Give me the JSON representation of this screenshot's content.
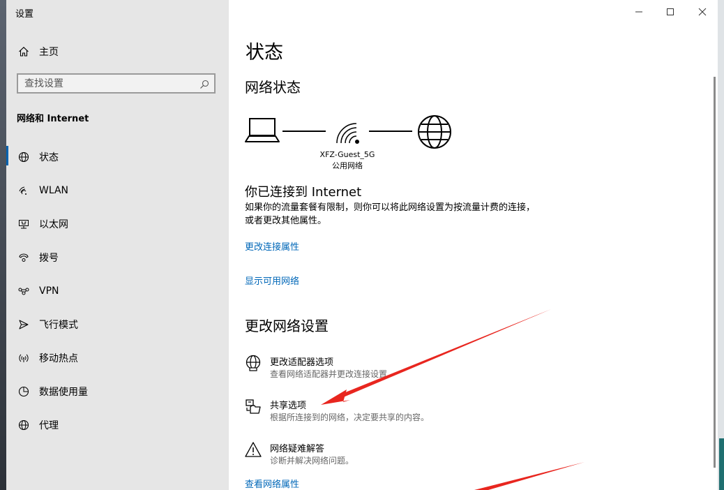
{
  "window": {
    "title": "设置"
  },
  "sidebar": {
    "home_label": "主页",
    "search_placeholder": "查找设置",
    "section_label": "网络和 Internet",
    "items": [
      {
        "label": "状态",
        "icon": "globe-icon"
      },
      {
        "label": "WLAN",
        "icon": "wifi-icon"
      },
      {
        "label": "以太网",
        "icon": "ethernet-icon"
      },
      {
        "label": "拨号",
        "icon": "dialup-icon"
      },
      {
        "label": "VPN",
        "icon": "vpn-icon"
      },
      {
        "label": "飞行模式",
        "icon": "airplane-icon"
      },
      {
        "label": "移动热点",
        "icon": "hotspot-icon"
      },
      {
        "label": "数据使用量",
        "icon": "data-usage-icon"
      },
      {
        "label": "代理",
        "icon": "proxy-globe-icon"
      }
    ]
  },
  "main": {
    "title": "状态",
    "network_status_heading": "网络状态",
    "network_name": "XFZ-Guest_5G",
    "network_type": "公用网络",
    "connected_title": "你已连接到 Internet",
    "connected_desc": "如果你的流量套餐有限制，则你可以将此网络设置为按流量计费的连接，或者更改其他属性。",
    "link_change_props": "更改连接属性",
    "link_show_networks": "显示可用网络",
    "change_settings_heading": "更改网络设置",
    "options": [
      {
        "title": "更改适配器选项",
        "desc": "查看网络适配器并更改连接设置。",
        "icon": "adapter-globe-icon"
      },
      {
        "title": "共享选项",
        "desc": "根据所连接到的网络，决定要共享的内容。",
        "icon": "sharing-icon"
      },
      {
        "title": "网络疑难解答",
        "desc": "诊断并解决网络问题。",
        "icon": "warning-icon"
      }
    ],
    "link_view_props": "查看网络属性"
  },
  "colors": {
    "accent": "#0063b1",
    "link": "#0067b8",
    "annotation": "#e8261f"
  }
}
